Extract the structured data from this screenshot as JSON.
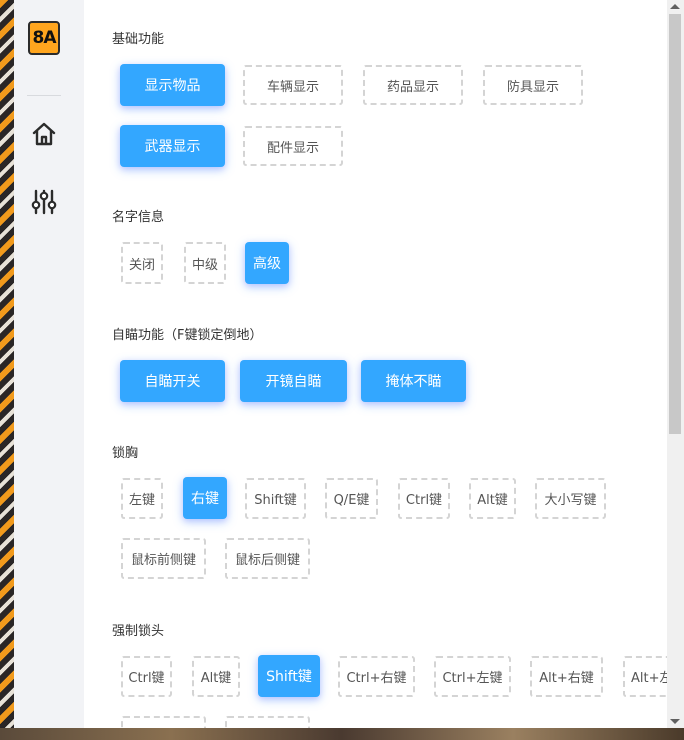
{
  "logo": "8A",
  "sidebar": {
    "items": [
      {
        "icon": "home-icon"
      },
      {
        "icon": "sliders-icon"
      }
    ]
  },
  "sections": {
    "basic": {
      "title": "基础功能",
      "buttons": [
        "显示物品",
        "车辆显示",
        "药品显示",
        "防具显示",
        "武器显示",
        "配件显示"
      ],
      "active": [
        true,
        false,
        false,
        false,
        true,
        false
      ]
    },
    "name": {
      "title": "名字信息",
      "buttons": [
        "关闭",
        "中级",
        "高级"
      ],
      "active": [
        false,
        false,
        true
      ]
    },
    "aim": {
      "title": "自瞄功能（F键锁定倒地）",
      "buttons": [
        "自瞄开关",
        "开镜自瞄",
        "掩体不瞄"
      ],
      "active": [
        true,
        true,
        true
      ]
    },
    "lock": {
      "title": "锁胸",
      "buttons": [
        "左键",
        "右键",
        "Shift键",
        "Q/E键",
        "Ctrl键",
        "Alt键",
        "大小写键",
        "鼠标前侧键",
        "鼠标后侧键"
      ],
      "active": [
        false,
        true,
        false,
        false,
        false,
        false,
        false,
        false,
        false
      ]
    },
    "force": {
      "title": "强制锁头",
      "buttons": [
        "Ctrl键",
        "Alt键",
        "Shift键",
        "Ctrl+右键",
        "Ctrl+左键",
        "Alt+右键",
        "Alt+左"
      ],
      "active": [
        false,
        false,
        true,
        false,
        false,
        false,
        false
      ]
    }
  },
  "colors": {
    "accent": "#33a7ff",
    "sidebar": "#f2f3f6",
    "logo": "#ffa51e"
  }
}
